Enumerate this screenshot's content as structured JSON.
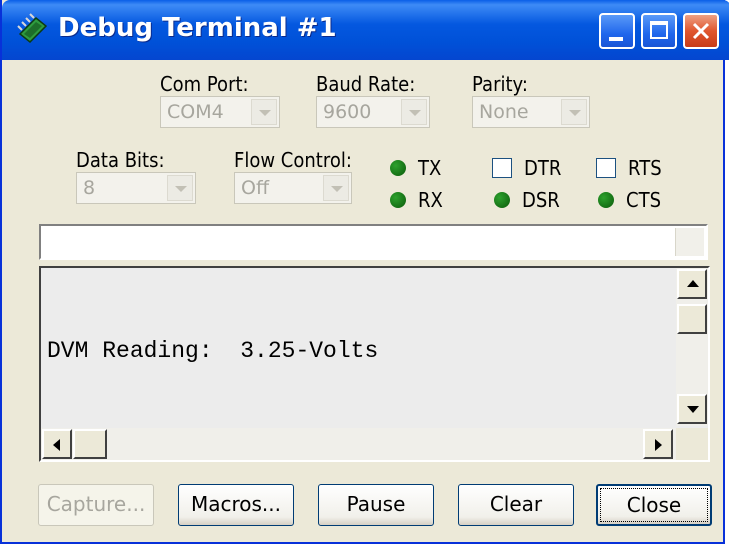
{
  "window": {
    "title": "Debug Terminal #1"
  },
  "titlebar": {
    "buttons": [
      "minimize",
      "maximize",
      "close"
    ]
  },
  "settings": {
    "com_port": {
      "label": "Com Port:",
      "value": "COM4"
    },
    "baud_rate": {
      "label": "Baud Rate:",
      "value": "9600"
    },
    "parity": {
      "label": "Parity:",
      "value": "None"
    },
    "data_bits": {
      "label": "Data Bits:",
      "value": "8"
    },
    "flow_control": {
      "label": "Flow Control:",
      "value": "Off"
    }
  },
  "indicators": {
    "tx": "TX",
    "rx": "RX",
    "dtr": "DTR",
    "rts": "RTS",
    "dsr": "DSR",
    "cts": "CTS",
    "led_color": "#0a7a0a"
  },
  "terminal": {
    "input_value": "",
    "output_text": "DVM Reading:  3.25-Volts"
  },
  "buttons": {
    "capture": "Capture...",
    "macros": "Macros...",
    "pause": "Pause",
    "clear": "Clear",
    "close": "Close"
  },
  "colors": {
    "titlebar": "#0458e0",
    "window_bg": "#ece9d8",
    "close_button": "#e0562e"
  }
}
